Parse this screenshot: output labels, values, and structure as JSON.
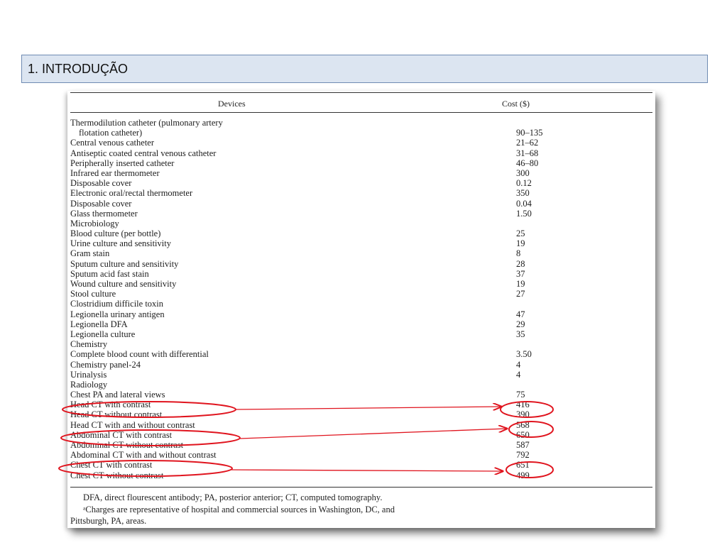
{
  "header": {
    "title": "1. INTRODUÇÃO"
  },
  "table": {
    "col_devices": "Devices",
    "col_cost": "Cost ($)",
    "rows": [
      {
        "device": "Thermodilution catheter (pulmonary artery",
        "cost": ""
      },
      {
        "device": "flotation catheter)",
        "cost": "90–135",
        "indent": true
      },
      {
        "device": "Central venous catheter",
        "cost": "21–62"
      },
      {
        "device": "Antiseptic coated central venous catheter",
        "cost": "31–68"
      },
      {
        "device": "Peripherally inserted catheter",
        "cost": "46–80"
      },
      {
        "device": "Infrared ear thermometer",
        "cost": "300"
      },
      {
        "device": "Disposable cover",
        "cost": "0.12"
      },
      {
        "device": "Electronic oral/rectal thermometer",
        "cost": "350"
      },
      {
        "device": "Disposable cover",
        "cost": "0.04"
      },
      {
        "device": "Glass thermometer",
        "cost": "1.50"
      },
      {
        "device": "Microbiology",
        "cost": ""
      },
      {
        "device": "Blood culture (per bottle)",
        "cost": "25"
      },
      {
        "device": "Urine culture and sensitivity",
        "cost": "19"
      },
      {
        "device": "Gram stain",
        "cost": "8"
      },
      {
        "device": "Sputum culture and sensitivity",
        "cost": "28"
      },
      {
        "device": "Sputum acid fast stain",
        "cost": "37"
      },
      {
        "device": "Wound culture and sensitivity",
        "cost": "19"
      },
      {
        "device": "Stool culture",
        "cost": "27"
      },
      {
        "device": "Clostridium difficile toxin",
        "cost": ""
      },
      {
        "device": "Legionella urinary antigen",
        "cost": "47"
      },
      {
        "device": "Legionella DFA",
        "cost": "29"
      },
      {
        "device": "Legionella culture",
        "cost": "35"
      },
      {
        "device": "Chemistry",
        "cost": ""
      },
      {
        "device": "Complete blood count with differential",
        "cost": "3.50"
      },
      {
        "device": "Chemistry panel-24",
        "cost": "4"
      },
      {
        "device": "Urinalysis",
        "cost": "4"
      },
      {
        "device": "Radiology",
        "cost": ""
      },
      {
        "device": "Chest PA and lateral views",
        "cost": "75"
      },
      {
        "device": "Head CT with contrast",
        "cost": "416"
      },
      {
        "device": "Head CT without contrast",
        "cost": "390"
      },
      {
        "device": "Head CT with and without contrast",
        "cost": "568"
      },
      {
        "device": "Abdominal CT with contrast",
        "cost": "650"
      },
      {
        "device": "Abdominal CT without contrast",
        "cost": "587"
      },
      {
        "device": "Abdominal CT with and without contrast",
        "cost": "792"
      },
      {
        "device": "Chest CT with contrast",
        "cost": "651"
      },
      {
        "device": "Chest CT without contrast",
        "cost": "499"
      }
    ],
    "footnote_1": "DFA, direct flourescent antibody; PA, posterior anterior; CT, computed tomography.",
    "footnote_2": "ᵃCharges are representative of hospital and commercial sources in Washington, DC, and",
    "footnote_3": "Pittsburgh, PA, areas."
  },
  "annotation_color": "#e0141e"
}
